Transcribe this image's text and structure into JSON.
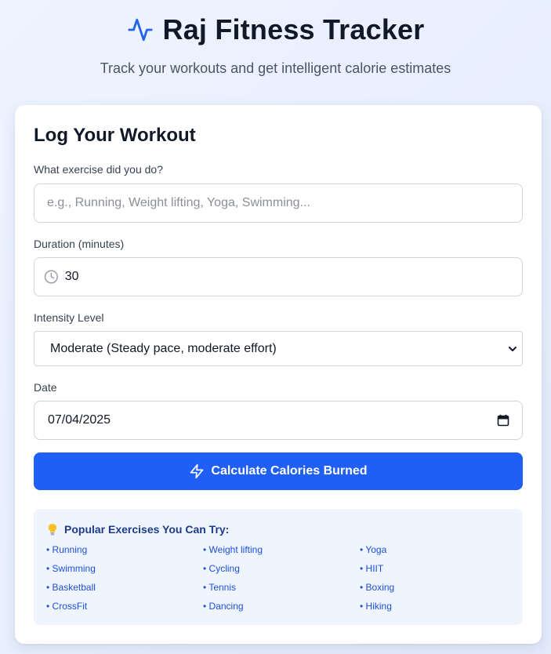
{
  "header": {
    "title": "Raj Fitness Tracker",
    "subtitle": "Track your workouts and get intelligent calorie estimates",
    "icon": "activity-pulse-icon"
  },
  "form": {
    "heading": "Log Your Workout",
    "exercise": {
      "label": "What exercise did you do?",
      "placeholder": "e.g., Running, Weight lifting, Yoga, Swimming...",
      "value": ""
    },
    "duration": {
      "label": "Duration (minutes)",
      "value": "30",
      "icon": "clock-icon"
    },
    "intensity": {
      "label": "Intensity Level",
      "selected": "Moderate (Steady pace, moderate effort)"
    },
    "date": {
      "label": "Date",
      "value": "07/04/2025",
      "icon": "calendar-icon"
    },
    "submit_label": "Calculate Calories Burned"
  },
  "suggestions": {
    "title": "Popular Exercises You Can Try:",
    "items": [
      "• Running",
      "• Weight lifting",
      "• Yoga",
      "• Swimming",
      "• Cycling",
      "• HIIT",
      "• Basketball",
      "• Tennis",
      "• Boxing",
      "• CrossFit",
      "• Dancing",
      "• Hiking"
    ]
  },
  "colors": {
    "accent": "#1f5ff5",
    "panel": "#eff5ff",
    "link": "#1d4ed8"
  }
}
